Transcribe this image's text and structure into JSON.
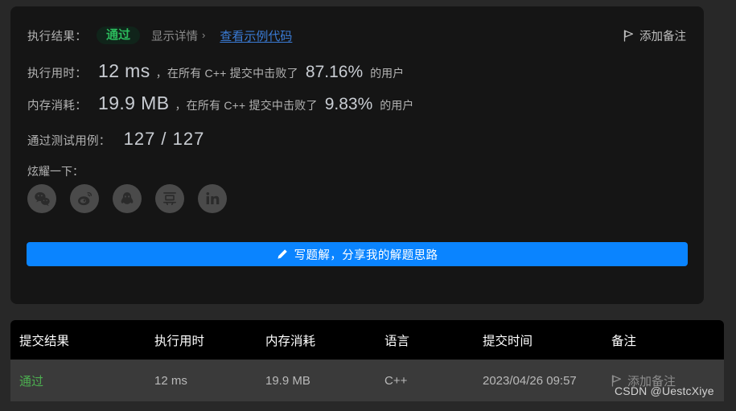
{
  "result_card": {
    "result_row": {
      "label": "执行结果：",
      "status": "通过",
      "detail_toggle": "显示详情",
      "detail_chevron": "›",
      "sample_code_link": "查看示例代码"
    },
    "add_note_top": {
      "label": "添加备注",
      "icon": "flag-icon"
    },
    "runtime": {
      "label": "执行用时：",
      "value": "12 ms",
      "middle_text": "，在所有 C++ 提交中击败了",
      "percent": "87.16%",
      "tail_text": "的用户"
    },
    "memory": {
      "label": "内存消耗：",
      "value": "19.9 MB",
      "middle_text": "，在所有 C++ 提交中击败了",
      "percent": "9.83%",
      "tail_text": "的用户"
    },
    "testcases": {
      "label": "通过测试用例：",
      "value": "127 / 127"
    },
    "share": {
      "label": "炫耀一下：",
      "icons": [
        {
          "name": "wechat-icon",
          "title": "微信"
        },
        {
          "name": "weibo-icon",
          "title": "微博"
        },
        {
          "name": "qq-icon",
          "title": "QQ"
        },
        {
          "name": "douban-icon",
          "title": "豆瓣"
        },
        {
          "name": "linkedin-icon",
          "title": "LinkedIn"
        }
      ]
    },
    "write_solution_button": {
      "label": "写题解，分享我的解题思路",
      "icon": "pencil-icon",
      "color": "#0a84ff"
    }
  },
  "submissions_table": {
    "headers": [
      "提交结果",
      "执行用时",
      "内存消耗",
      "语言",
      "提交时间",
      "备注"
    ],
    "rows": [
      {
        "status": "通过",
        "runtime": "12 ms",
        "memory": "19.9 MB",
        "language": "C++",
        "submitted_at": "2023/04/26 09:57",
        "note": "添加备注"
      }
    ]
  },
  "watermark": "CSDN @UestcXiye",
  "colors": {
    "accent_blue": "#0a84ff",
    "pass_green": "#2cbb5d",
    "link_blue": "#3a7bd5",
    "row_bg": "#3a3a3a",
    "card_bg": "#151515"
  }
}
